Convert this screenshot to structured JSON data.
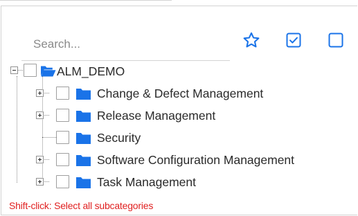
{
  "search": {
    "placeholder": "Search..."
  },
  "toolbar": {
    "favorite_icon": "star-outline-icon",
    "select_all_icon": "checked-box-icon",
    "deselect_all_icon": "empty-box-icon",
    "accent": "#1a73e8"
  },
  "tree": {
    "root": {
      "label": "ALM_DEMO",
      "icon": "folder-open-icon",
      "expanded": true
    },
    "children": [
      {
        "label": "Change & Defect Management",
        "expandable": true
      },
      {
        "label": "Release Management",
        "expandable": true
      },
      {
        "label": "Security",
        "expandable": false
      },
      {
        "label": "Software Configuration Management",
        "expandable": true
      },
      {
        "label": "Task Management",
        "expandable": true
      }
    ],
    "folder_color": "#1a73e8"
  },
  "hint": {
    "text": "Shift-click: Select all subcategories",
    "color": "#e02020"
  }
}
